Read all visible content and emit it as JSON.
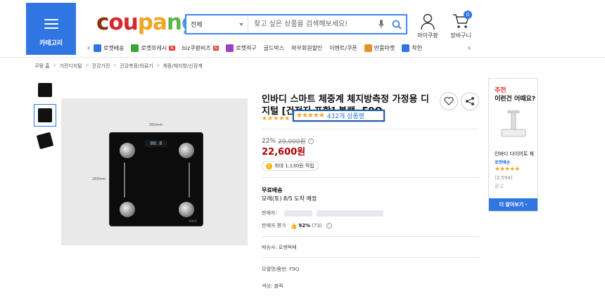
{
  "header": {
    "category_label": "카테고리",
    "logo_letters": [
      "c",
      "ou",
      "pa",
      "n",
      "g"
    ],
    "search": {
      "category_value": "전체",
      "placeholder": "찾고 싶은 상품을 검색해보세요!"
    },
    "my_coupang": "마이쿠팡",
    "cart": {
      "label": "장바구니",
      "count": "0"
    }
  },
  "nav": {
    "items": [
      {
        "label": "로켓배송",
        "icon": "rocket-icon",
        "color": "#2f76e3",
        "new": ""
      },
      {
        "label": "로켓프레시",
        "icon": "rocket-fresh-icon",
        "color": "#3aa63a",
        "new": "N"
      },
      {
        "label": "biz쿠팡비즈",
        "icon": "",
        "color": "",
        "new": "N"
      },
      {
        "label": "로켓직구",
        "icon": "rocket-direct-icon",
        "color": "#a040c0",
        "new": ""
      },
      {
        "label": "골드박스",
        "icon": "",
        "color": "",
        "new": ""
      },
      {
        "label": "와우회원할인",
        "icon": "",
        "color": "",
        "new": ""
      },
      {
        "label": "이벤트/쿠폰",
        "icon": "",
        "color": "",
        "new": ""
      },
      {
        "label": "반품마켓",
        "icon": "return-market-icon",
        "color": "#e88f2c",
        "new": ""
      },
      {
        "label": "착한",
        "icon": "good-icon",
        "color": "#2f76e3",
        "new": ""
      }
    ]
  },
  "breadcrumb": [
    "쿠팡 홈",
    "가전디지털",
    "건강가전",
    "건강측정/의료기",
    "체중/체지방/신장계"
  ],
  "product": {
    "image_labels": {
      "width": "260mm",
      "height": "260mm",
      "display": "88.8",
      "brand": "KALIF"
    },
    "title": "인바디 스마트 체중계 체지방측정 가정용 디지털 [건전지 포함] 블랙, F9Q",
    "rating_stars": "★★★★★",
    "rating_value": 4.5,
    "review_count": "432개 상품평",
    "discount": "22%",
    "old_price": "29,000원",
    "price": "22,600원",
    "cashback": "최대 1,130원 적립",
    "shipping_title": "무료배송",
    "shipping_date": "모레(토) 8/5 도착 예정",
    "seller_label": "판매자:",
    "seller_rating_label": "판매자 평가",
    "seller_rating_value": "92%",
    "seller_rating_count": "(73)",
    "delivery": "배송사: 로젠택배",
    "model": "모델명/품번: F9Q",
    "color": "색상: 블랙"
  },
  "recommend": {
    "tag": "추천",
    "title": "이런건 어때요?",
    "product_name": "인바디 다이어트 체중계",
    "rocket": "로켓배송",
    "stars": "★★★★★",
    "count": "(2,594)",
    "ad": "광고",
    "more": "더 알아보기 ›"
  }
}
